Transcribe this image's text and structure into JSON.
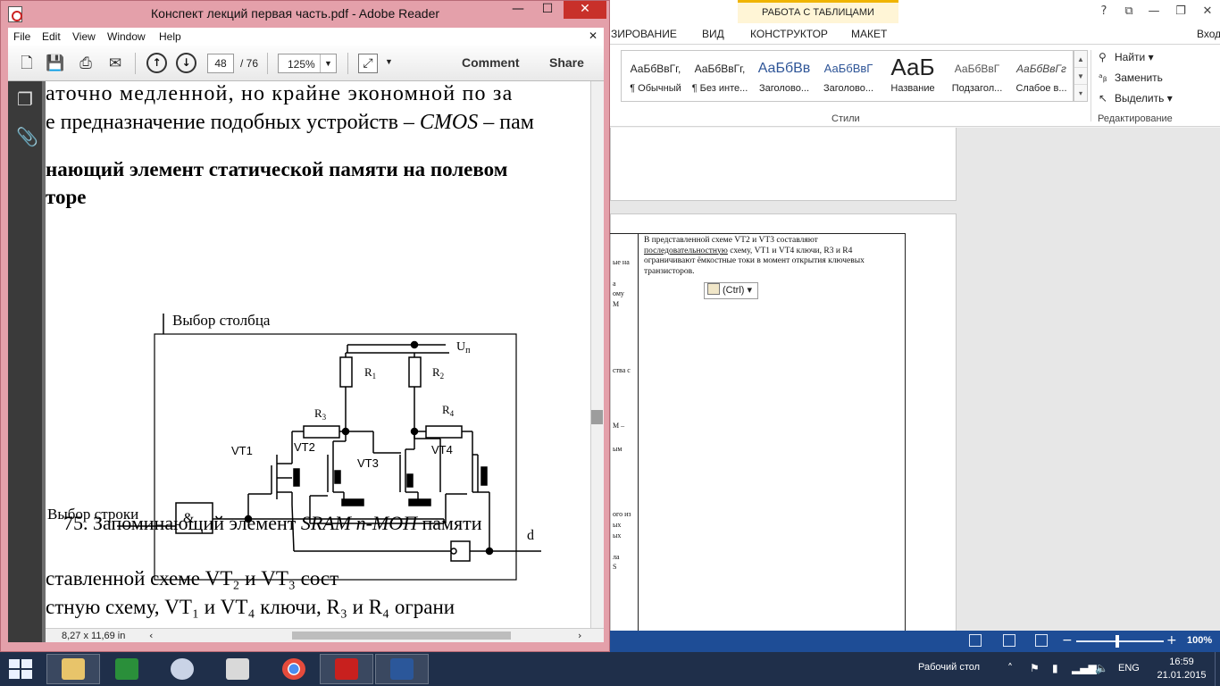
{
  "word": {
    "context_tab": "РАБОТА С ТАБЛИЦАМИ",
    "title_controls": [
      "?",
      "⧉",
      "—",
      "❐",
      "✕"
    ],
    "ribbon_tabs": [
      "ЗИРОВАНИЕ",
      "ВИД",
      "КОНСТРУКТОР",
      "МАКЕТ",
      "Вход"
    ],
    "styles": [
      {
        "sample": "АаБбВвГг,",
        "name": "¶ Обычный"
      },
      {
        "sample": "АаБбВвГг,",
        "name": "¶ Без инте..."
      },
      {
        "sample": "АаБбВв",
        "name": "Заголово..."
      },
      {
        "sample": "АаБбВвГ",
        "name": "Заголово..."
      },
      {
        "sample": "АаБ",
        "name": "Название"
      },
      {
        "sample": "АаБбВвГ",
        "name": "Подзагол..."
      },
      {
        "sample": "АаБбВвГг",
        "name": "Слабое в..."
      }
    ],
    "styles_group_label": "Стили",
    "editing": {
      "find": "Найти",
      "replace": "Заменить",
      "select": "Выделить",
      "group_label": "Редактирование"
    },
    "cell_text_1": "В представленной схеме VT2 и VT3 составляют ",
    "cell_text_ul": "последовательностную",
    "cell_text_2": " схему, VT1 и VT4 ключи, R3 и R4 ограничивают ёмкостные токи в момент открытия ключевых транзисторов.",
    "paste_button": "(Ctrl)",
    "left_fragments": [
      "ые на",
      "а",
      "ому",
      "M",
      "ства с",
      "M –",
      "ым",
      "ого из",
      "ых",
      "ых",
      "ла",
      "S"
    ],
    "zoom": "100%"
  },
  "reader": {
    "title": "Конспект лекций первая часть.pdf - Adobe Reader",
    "menu": [
      "File",
      "Edit",
      "View",
      "Window",
      "Help"
    ],
    "page_current": "48",
    "page_total": "/ 76",
    "zoom": "125%",
    "comment": "Comment",
    "share": "Share",
    "page_size": "8,27 x 11,69 in",
    "text": {
      "line1": "аточно медленной, но крайне экономной по за",
      "line2a": "е предназначение подобных устройств – ",
      "line2b": "CMOS",
      "line2c": " – пам",
      "heading1": "нающий элемент статической памяти на полевом",
      "heading2": "торе",
      "caption_a": "75. Запоминающий элемент ",
      "caption_b": "SRAM n-МОП",
      "caption_c": " памяти",
      "p1": "ставленной    схеме    VT₂      и      VT₃  сост",
      "p2": "стную схему,  VT₁ и  VT₄  ключи,  R₃ и R₄  ограни"
    },
    "diagram": {
      "col_select": "Выбор столбца",
      "row_select": "Выбор строки",
      "and_gate": "&",
      "supply": "U",
      "supply_sub": "п",
      "output": "d",
      "resistors": [
        {
          "name": "R",
          "sub": "1"
        },
        {
          "name": "R",
          "sub": "2"
        },
        {
          "name": "R",
          "sub": "3"
        },
        {
          "name": "R",
          "sub": "4"
        }
      ],
      "transistors": [
        "VT1",
        "VT2",
        "VT3",
        "VT4"
      ]
    }
  },
  "taskbar": {
    "desktop_label": "Рабочий стол",
    "lang": "ENG",
    "time": "16:59",
    "date": "21.01.2015"
  }
}
